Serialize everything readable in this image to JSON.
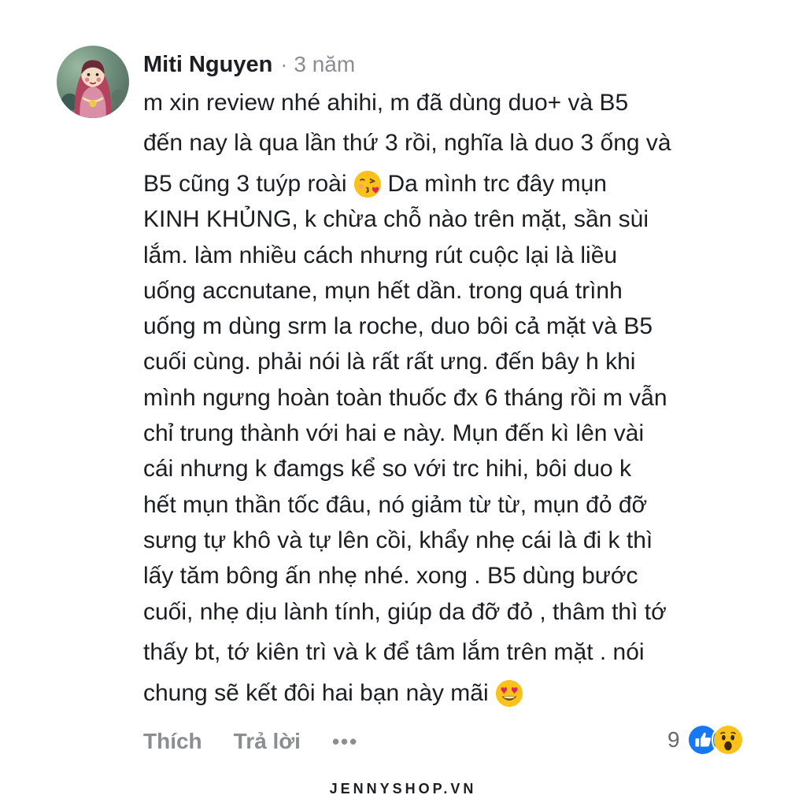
{
  "comment": {
    "author": "Miti Nguyen",
    "separator": "·",
    "timestamp": "3 năm",
    "lines": [
      "m xin review nhé ahihi, m đã dùng duo+ và B5",
      "đến nay là qua lần thứ 3 rồi, nghĩa là duo 3 ống và",
      "B5 cũng 3 tuýp roài",
      "Da mình trc đây mụn",
      "KINH KHỦNG, k chừa chỗ nào trên mặt, sần sùi",
      "lắm. làm nhiều cách nhưng rút cuộc lại là liều",
      "uống accnutane, mụn hết dần. trong quá trình",
      "uống m dùng srm la roche, duo bôi cả mặt và B5",
      "cuối cùng. phải nói là rất rất ưng. đến bây h khi",
      "mình ngưng hoàn toàn thuốc đx 6 tháng rồi m vẫn",
      "chỉ trung thành với hai e này. Mụn đến kì lên vài",
      "cái nhưng k đamgs kể so với trc hihi, bôi duo k",
      "hết mụn thần tốc đâu, nó giảm từ từ, mụn đỏ đỡ",
      "sưng tự khô và tự lên cồi, khẩy nhẹ cái là đi k thì",
      "lấy tăm bông ấn nhẹ nhé. xong . B5 dùng bước",
      "cuối, nhẹ dịu lành tính, giúp da đỡ đỏ , thâm thì tớ",
      "thấy bt, tớ kiên trì và k để tâm lắm trên mặt . nói",
      "chung sẽ kết đôi hai bạn này mãi"
    ],
    "emojis": [
      "face-blowing-kiss",
      "smiling-face-heart-eyes"
    ]
  },
  "actions": {
    "like_label": "Thích",
    "reply_label": "Trả lời",
    "more_label": "•••"
  },
  "reactions": {
    "count": "9",
    "icons": [
      "like-reaction",
      "wow-reaction"
    ]
  },
  "watermark": "JENNYSHOP.VN",
  "colors": {
    "text": "#1c1e21",
    "muted": "#8a8d91",
    "like_blue": "#1877f2",
    "emoji_yellow": "#fcc21b"
  }
}
